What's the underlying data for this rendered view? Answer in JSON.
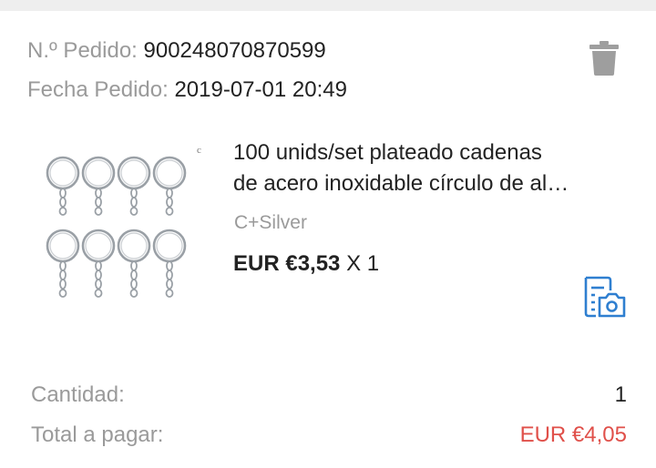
{
  "order": {
    "number_label": "N.º Pedido:",
    "number_value": "9002480708705​99",
    "date_label": "Fecha Pedido:",
    "date_value": "2019-07-01 20:49"
  },
  "product": {
    "title_line1": "100 unids/set plateado cadenas",
    "title_line2": "de acero inoxidable círculo de al…",
    "variant": "C+Silver",
    "price": "EUR €3,53",
    "quantity_text": "X 1",
    "image_corner_mark": "c"
  },
  "summary": {
    "quantity_label": "Cantidad:",
    "quantity_value": "1",
    "total_label": "Total a pagar:",
    "total_value": "EUR €4,05"
  },
  "icons": {
    "delete": "trash-icon",
    "receipt_photo": "receipt-camera-icon"
  },
  "colors": {
    "label_gray": "#9a9a9a",
    "text_dark": "#222222",
    "total_red": "#e0504a",
    "icon_blue": "#2f7fd0",
    "icon_gray": "#9e9e9e"
  }
}
